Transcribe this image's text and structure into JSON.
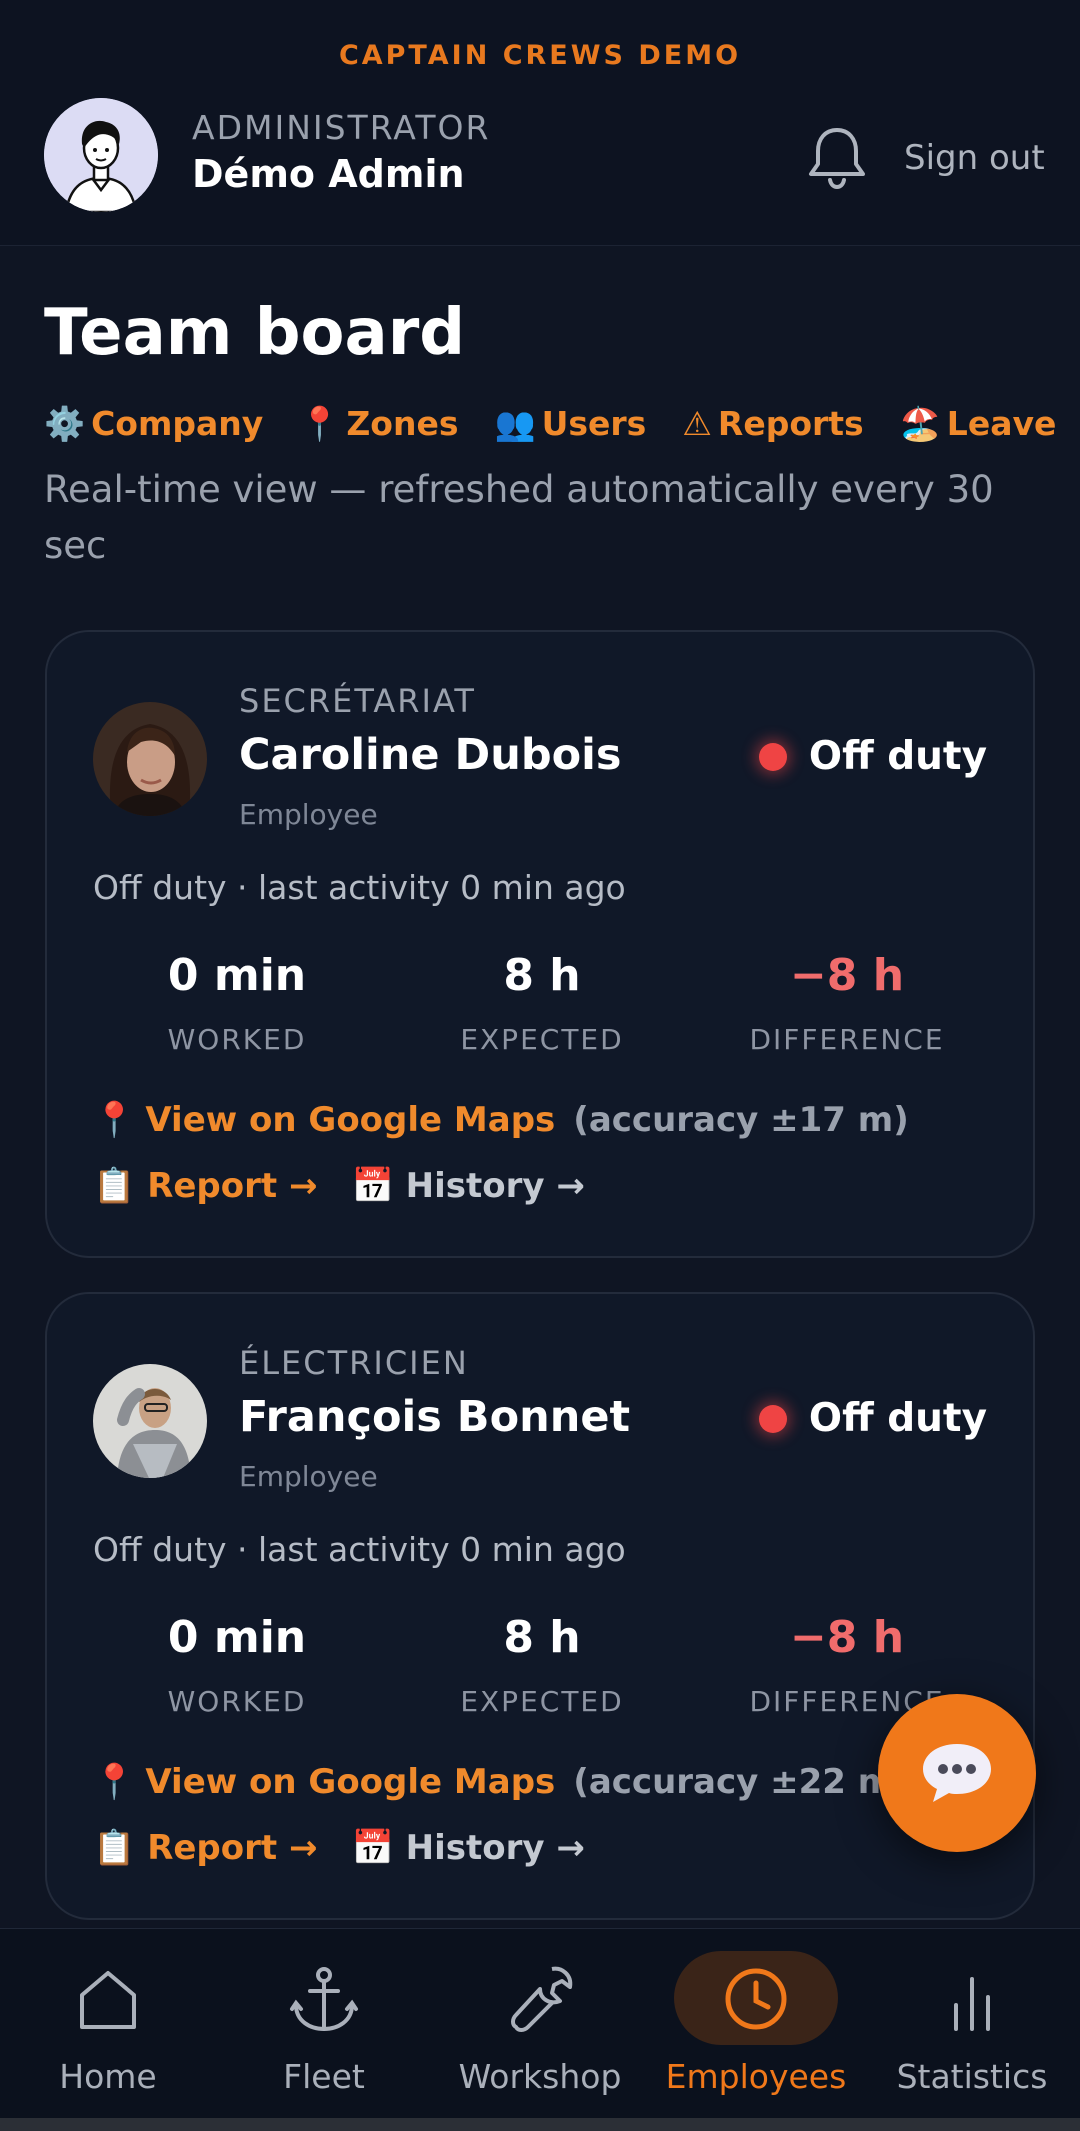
{
  "header": {
    "brand": "CAPTAIN CREWS DEMO",
    "role": "ADMINISTRATOR",
    "user_name": "Démo Admin",
    "sign_out": "Sign out"
  },
  "page": {
    "title": "Team board",
    "links": [
      {
        "icon": "⚙️",
        "label": "Company"
      },
      {
        "icon": "📍",
        "label": "Zones"
      },
      {
        "icon": "👥",
        "label": "Users"
      },
      {
        "icon": "⚠",
        "label": "Reports"
      },
      {
        "icon": "🏖️",
        "label": "Leave"
      }
    ],
    "subtitle": "Real-time view — refreshed automatically every 30 sec"
  },
  "employees": [
    {
      "department": "SECRÉTARIAT",
      "name": "Caroline Dubois",
      "role": "Employee",
      "status": "Off duty",
      "activity": "Off duty · last activity 0 min ago",
      "worked_value": "0 min",
      "worked_label": "WORKED",
      "expected_value": "8 h",
      "expected_label": "EXPECTED",
      "difference_value": "−8 h",
      "difference_label": "DIFFERENCE",
      "maps_icon": "📍",
      "maps_label": "View on Google Maps",
      "accuracy": "(accuracy ±17 m)",
      "report_icon": "📋",
      "report_label": "Report →",
      "history_icon": "📅",
      "history_label": "History →"
    },
    {
      "department": "ÉLECTRICIEN",
      "name": "François Bonnet",
      "role": "Employee",
      "status": "Off duty",
      "activity": "Off duty · last activity 0 min ago",
      "worked_value": "0 min",
      "worked_label": "WORKED",
      "expected_value": "8 h",
      "expected_label": "EXPECTED",
      "difference_value": "−8 h",
      "difference_label": "DIFFERENCE",
      "maps_icon": "📍",
      "maps_label": "View on Google Maps",
      "accuracy": "(accuracy ±22 m)",
      "report_icon": "📋",
      "report_label": "Report →",
      "history_icon": "📅",
      "history_label": "History →"
    }
  ],
  "nav": [
    {
      "label": "Home",
      "icon": "home-icon"
    },
    {
      "label": "Fleet",
      "icon": "anchor-icon"
    },
    {
      "label": "Workshop",
      "icon": "wrench-icon"
    },
    {
      "label": "Employees",
      "icon": "clock-icon",
      "active": true
    },
    {
      "label": "Statistics",
      "icon": "bar-chart-icon"
    }
  ],
  "colors": {
    "accent": "#f0781a",
    "background": "#0f1523",
    "status_off": "#ef4444",
    "negative": "#f06c6c"
  }
}
